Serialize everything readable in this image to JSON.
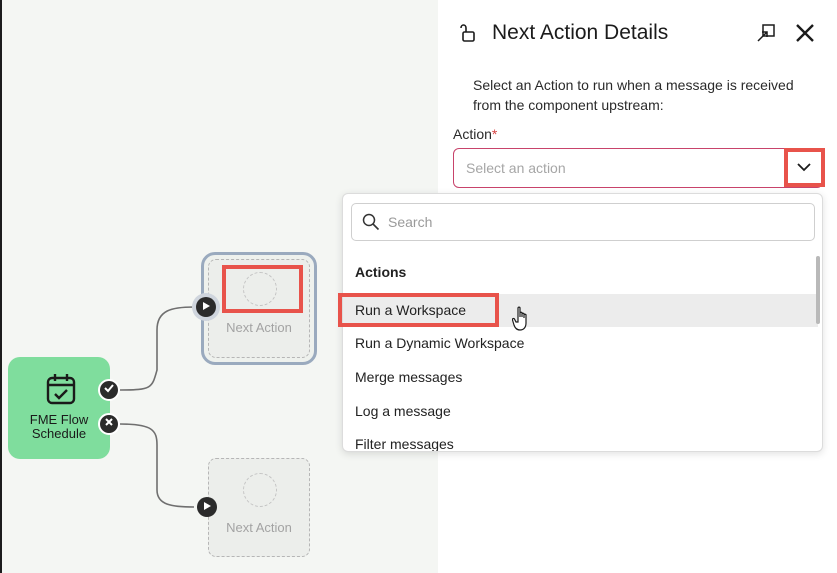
{
  "canvas": {
    "source_node": {
      "label_line1": "FME Flow",
      "label_line2": "Schedule"
    },
    "target_nodes": [
      {
        "label": "Next Action"
      },
      {
        "label": "Next Action"
      }
    ]
  },
  "panel": {
    "title": "Next Action Details",
    "description": "Select an Action to run when a message is received from the component upstream:",
    "field_label": "Action",
    "required_mark": "*",
    "select_placeholder": "Select an action"
  },
  "dropdown": {
    "search_placeholder": "Search",
    "group_heading": "Actions",
    "options": [
      "Run a Workspace",
      "Run a Dynamic Workspace",
      "Merge messages",
      "Log a message",
      "Filter messages"
    ]
  },
  "colors": {
    "highlight": "#e8534b",
    "source_node": "#7fdd9d",
    "select_border": "#c8436b"
  }
}
